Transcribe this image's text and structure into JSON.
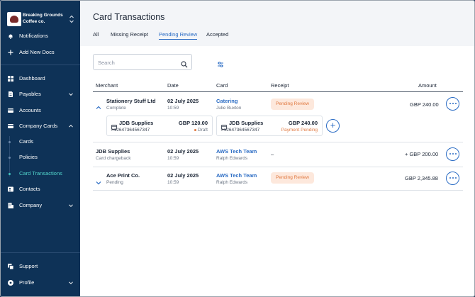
{
  "sidebar": {
    "org_name": "Breaking Grounds Coffee co.",
    "top_items": [
      {
        "label": "Notifications",
        "icon": "bell-icon"
      },
      {
        "label": "Add New Docs",
        "icon": "plus-icon"
      }
    ],
    "items": [
      {
        "label": "Dashboard",
        "icon": "dashboard-icon"
      },
      {
        "label": "Payables",
        "icon": "document-icon"
      },
      {
        "label": "Accounts",
        "icon": "bank-icon"
      },
      {
        "label": "Company Cards",
        "icon": "card-icon"
      }
    ],
    "sub_items": [
      {
        "label": "Cards"
      },
      {
        "label": "Policies"
      },
      {
        "label": "Card Transactions"
      }
    ],
    "lower_items": [
      {
        "label": "Contacts",
        "icon": "contacts-icon"
      },
      {
        "label": "Company",
        "icon": "building-icon"
      }
    ],
    "bottom_items": [
      {
        "label": "Support",
        "icon": "support-icon"
      },
      {
        "label": "Profile",
        "icon": "profile-icon"
      }
    ],
    "accent": "#52d4cb"
  },
  "main": {
    "title": "Card Transactions",
    "tabs": [
      {
        "label": "All"
      },
      {
        "label": "Missing Receipt"
      },
      {
        "label": "Pending Review"
      },
      {
        "label": "Accepted"
      }
    ],
    "active_tab": "Pending Review",
    "search": {
      "placeholder": "Search",
      "value": ""
    },
    "columns": {
      "merchant": "Merchant",
      "date": "Date",
      "card": "Card",
      "receipt": "Receipt",
      "amount": "Amount"
    },
    "rows": [
      {
        "merchant": "Stationery Stuff Ltd",
        "merchant_sub": "Complete",
        "date": "02 July 2025",
        "time": "10:59",
        "card": "Catering",
        "card_holder": "Julie Buxton",
        "receipt_badge": "Pending Review",
        "amount": "GBP 240.00",
        "expanded": true,
        "receipts": [
          {
            "name": "JDB Supplies",
            "ref": "#12647364567347",
            "amount": "GBP 120.00",
            "status": "Draft"
          },
          {
            "name": "JDB Supplies",
            "ref": "#12647364567347",
            "amount": "GBP 240.00",
            "status": "Payment Pending"
          }
        ]
      },
      {
        "merchant": "JDB Supplies",
        "merchant_sub": "Card chargeback",
        "date": "02 July 2025",
        "time": "10:59",
        "card": "AWS Tech Team",
        "card_holder": "Ralph Edwards",
        "receipt_text": "–",
        "amount": "+ GBP 200.00"
      },
      {
        "merchant": "Ace Print Co.",
        "merchant_sub": "Pending",
        "date": "02 July 2025",
        "time": "10:59",
        "card": "AWS Tech Team",
        "card_holder": "Ralph Edwards",
        "receipt_badge": "Pending Review",
        "amount": "GBP 2,345.88"
      }
    ]
  },
  "colors": {
    "sidebar_bg": "#0e3257",
    "link": "#2b6cc4",
    "badge_bg": "#fde8dc",
    "badge_text": "#e0783f"
  }
}
